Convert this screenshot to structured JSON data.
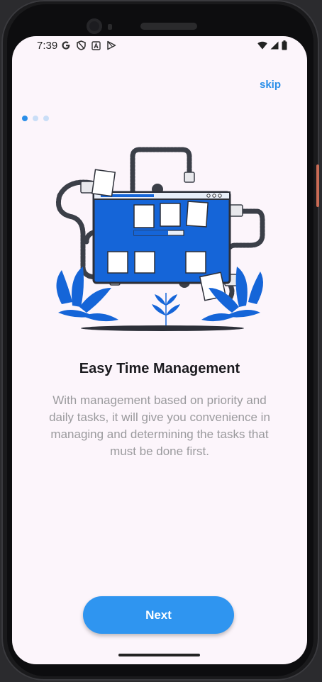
{
  "status_bar": {
    "time": "7:39",
    "left_icons": [
      "google-g-icon",
      "shield-icon",
      "a-badge-icon",
      "play-store-icon"
    ],
    "right_icons": [
      "wifi-icon",
      "signal-icon",
      "battery-icon"
    ]
  },
  "onboarding": {
    "skip_label": "skip",
    "page_count": 3,
    "active_page": 1,
    "title": "Easy Time Management",
    "description": "With management based on priority and daily tasks, it will give you convenience in managing and determining the tasks that must be done first.",
    "next_label": "Next"
  },
  "colors": {
    "accent": "#2f95f0",
    "background": "#fcf5fb",
    "illustration_blue": "#1565d8"
  }
}
